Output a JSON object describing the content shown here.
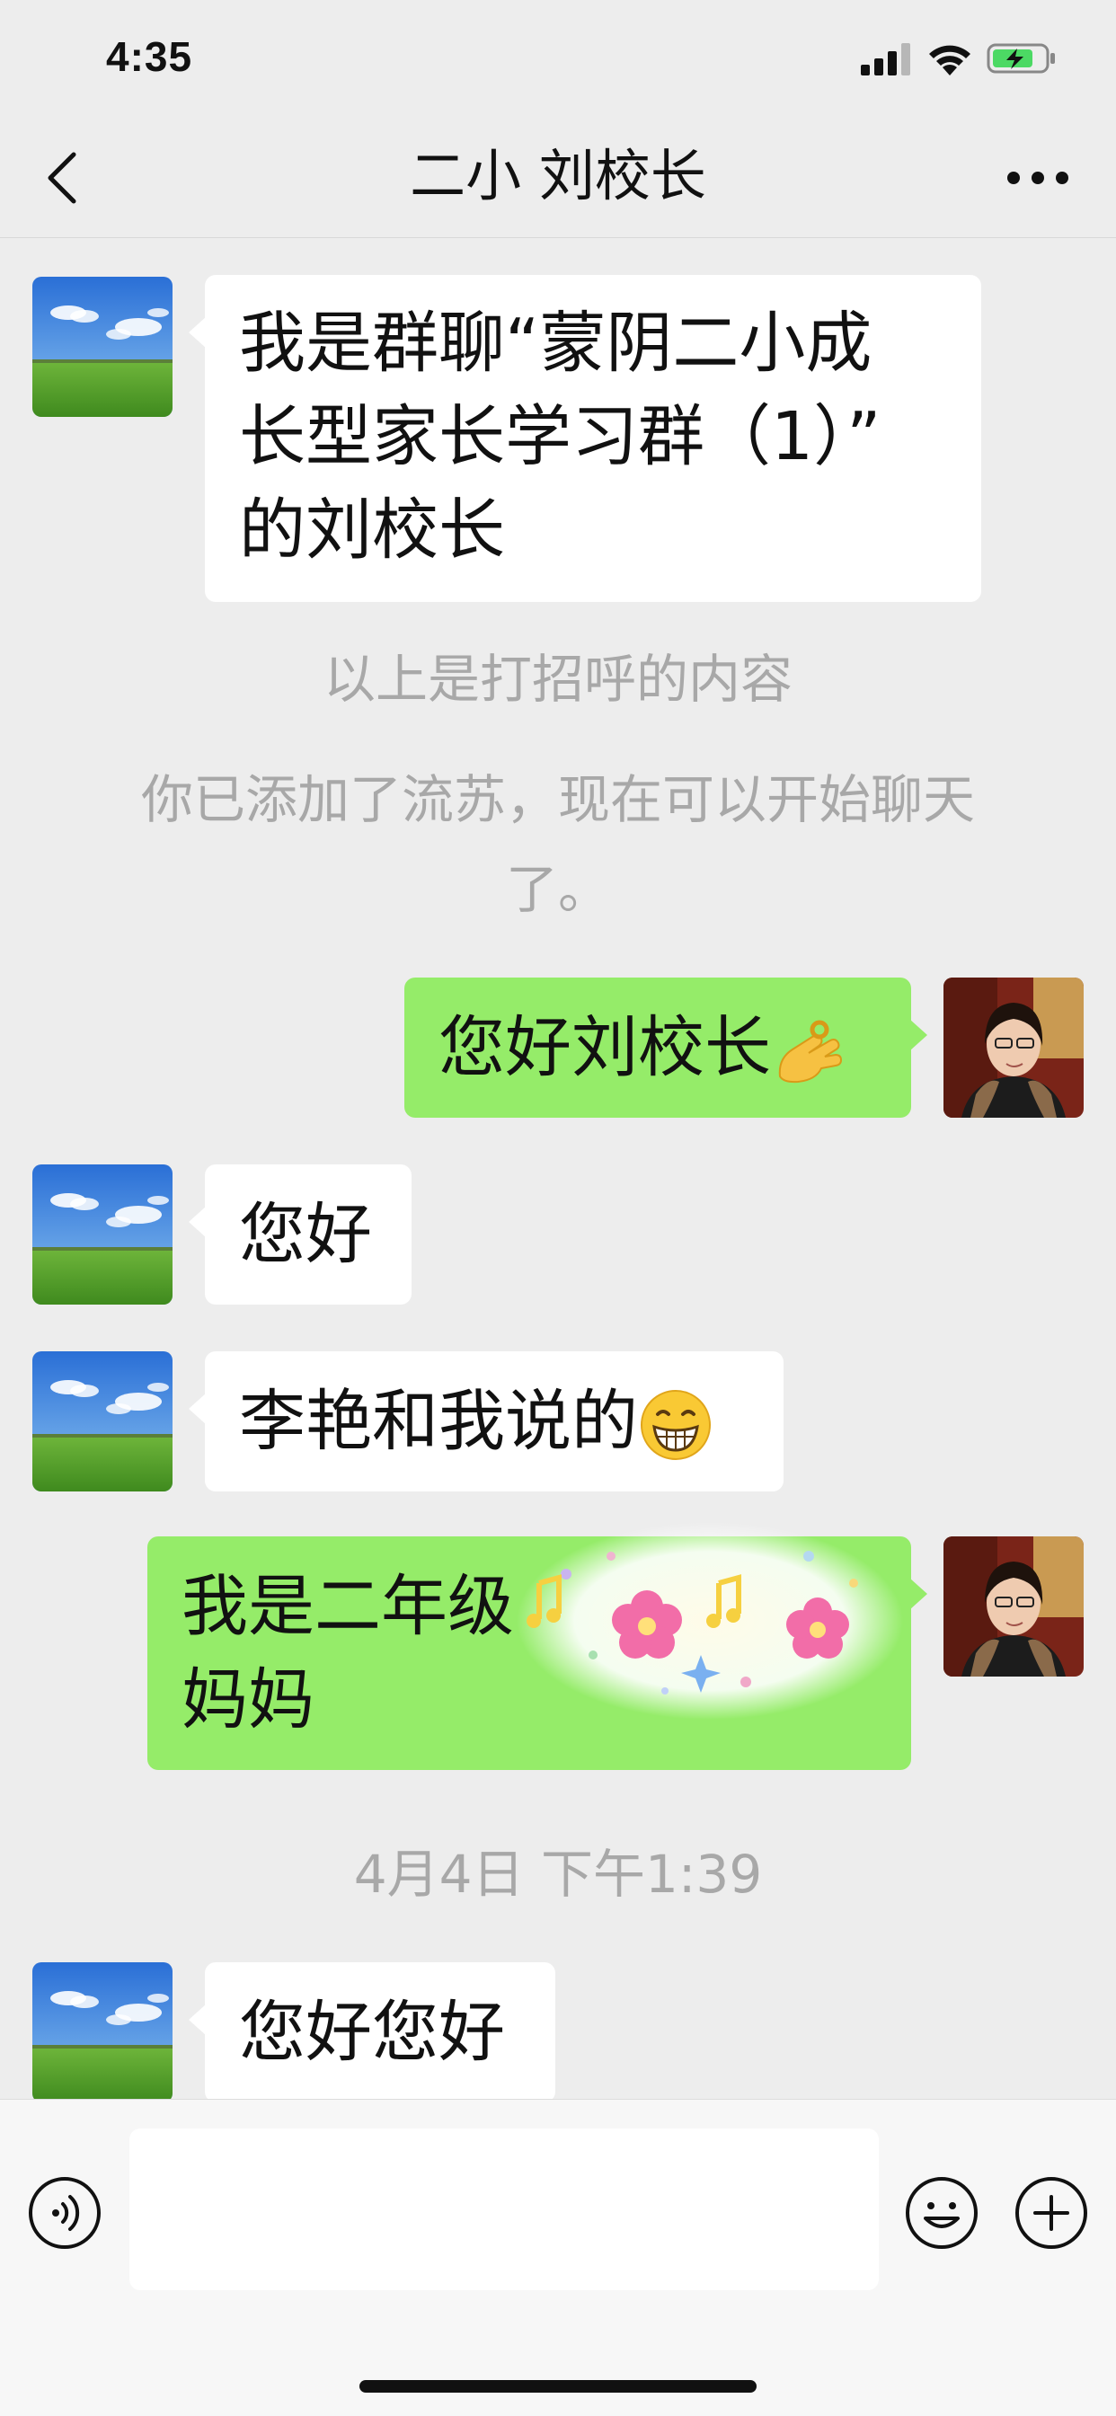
{
  "status_bar": {
    "time": "4:35"
  },
  "header": {
    "title": "二小 刘校长"
  },
  "messages": {
    "m1": {
      "side": "left",
      "lines": [
        "我是群聊“蒙阴二小成",
        "长型家长学习群（1）”",
        "的刘校长"
      ]
    },
    "sys1": "以上是打招呼的内容",
    "sys2_lines": [
      "你已添加了流苏，现在可以开始聊天",
      "了。"
    ],
    "m2": {
      "side": "right",
      "text": "您好刘校长",
      "emoji": "ok-hand-emoji"
    },
    "m3": {
      "side": "left",
      "text": "您好"
    },
    "m4": {
      "side": "left",
      "text": "李艳和我说的",
      "emoji": "grinning-face-emoji"
    },
    "m5": {
      "side": "right",
      "lines": [
        "我是二年级",
        "妈妈"
      ],
      "overlay": "sticker-flowers-music"
    },
    "timestamp": "4月4日 下午1:39",
    "m6": {
      "side": "left",
      "text": "您好您好"
    }
  },
  "input_bar": {
    "placeholder": ""
  },
  "colors": {
    "background": "#ededed",
    "self_bubble": "#95ec69",
    "other_bubble": "#ffffff",
    "system_text": "#a8a8a8",
    "battery_fill": "#4cd964"
  },
  "icons": [
    "back-arrow-icon",
    "more-icon",
    "voice-icon",
    "emoji-icon",
    "plus-icon",
    "signal-icon",
    "wifi-icon",
    "battery-icon"
  ]
}
